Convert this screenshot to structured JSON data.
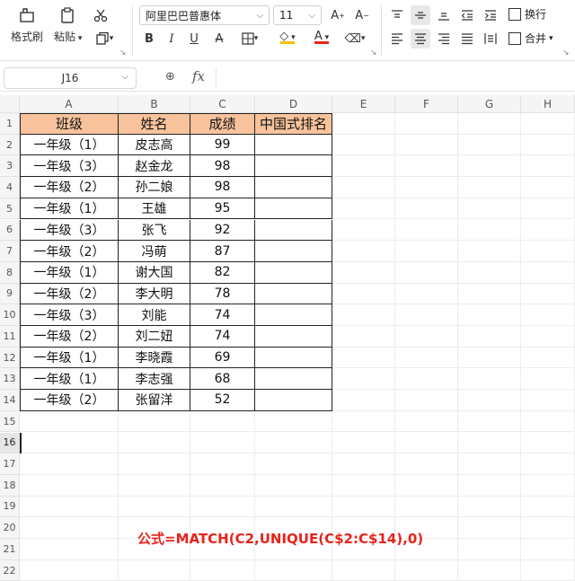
{
  "ribbon": {
    "format_painter": "格式刷",
    "paste": "粘贴",
    "font_name": "阿里巴巴普惠体",
    "font_size": "11",
    "wrap_text": "换行",
    "merge": "合并"
  },
  "name_box": "J16",
  "fx_label": "fx",
  "columns": [
    "A",
    "B",
    "C",
    "D",
    "E",
    "F",
    "G",
    "H"
  ],
  "rows": [
    "1",
    "2",
    "3",
    "4",
    "5",
    "6",
    "7",
    "8",
    "9",
    "10",
    "11",
    "12",
    "13",
    "14",
    "15",
    "16",
    "17",
    "18",
    "19",
    "20",
    "21",
    "22"
  ],
  "table": {
    "headers": [
      "班级",
      "姓名",
      "成绩",
      "中国式排名"
    ],
    "rows": [
      [
        "一年级（1）",
        "皮志高",
        "99",
        ""
      ],
      [
        "一年级（3）",
        "赵金龙",
        "98",
        ""
      ],
      [
        "一年级（2）",
        "孙二娘",
        "98",
        ""
      ],
      [
        "一年级（1）",
        "王雄",
        "95",
        ""
      ],
      [
        "一年级（3）",
        "张飞",
        "92",
        ""
      ],
      [
        "一年级（2）",
        "冯萌",
        "87",
        ""
      ],
      [
        "一年级（1）",
        "谢大国",
        "82",
        ""
      ],
      [
        "一年级（2）",
        "李大明",
        "78",
        ""
      ],
      [
        "一年级（3）",
        "刘能",
        "74",
        ""
      ],
      [
        "一年级（2）",
        "刘二妞",
        "74",
        ""
      ],
      [
        "一年级（1）",
        "李晓霞",
        "69",
        ""
      ],
      [
        "一年级（1）",
        "李志强",
        "68",
        ""
      ],
      [
        "一年级（2）",
        "张留洋",
        "52",
        ""
      ]
    ]
  },
  "formula_note": "公式=MATCH(C2,UNIQUE(C$2:C$14),0)",
  "colors": {
    "header_fill": "#f8c39c",
    "note_red": "#e8231b",
    "font_color_bar": "#e8231b",
    "fill_color_bar": "#f2c200"
  }
}
